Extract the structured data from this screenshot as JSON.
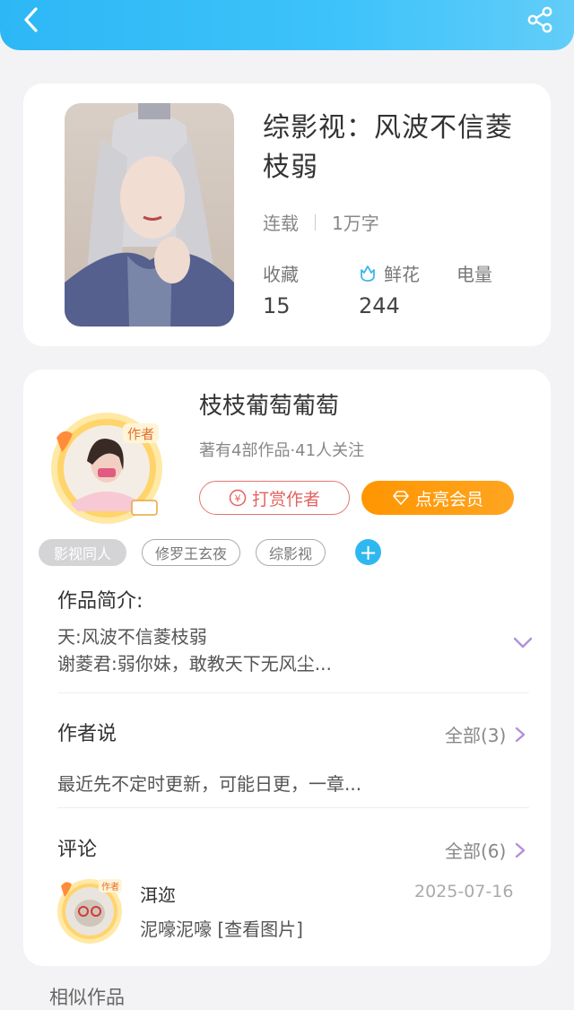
{
  "header": {
    "back_icon": "chevron-left-icon",
    "share_icon": "share-icon"
  },
  "book": {
    "title": "综影视：风波不信菱枝弱",
    "status": "连载",
    "word_count": "1万字",
    "stats": {
      "favorites_label": "收藏",
      "favorites_value": "15",
      "flowers_label": "鲜花",
      "flowers_value": "244",
      "power_label": "电量"
    }
  },
  "author": {
    "name": "枝枝葡萄葡萄",
    "info": "著有4部作品·41人关注",
    "badge": "作者",
    "reward_button": "打赏作者",
    "vip_button": "点亮会员",
    "tags": [
      "影视同人",
      "修罗王玄夜",
      "综影视"
    ],
    "add_tag": "+"
  },
  "intro": {
    "title": "作品简介:",
    "line1": "天:风波不信菱枝弱",
    "line2": "谢菱君:弱你妹，敢教天下无风尘..."
  },
  "author_say": {
    "title": "作者说",
    "more": "全部(3)",
    "text": "最近先不定时更新，可能日更，一章..."
  },
  "comments": {
    "title": "评论",
    "more": "全部(6)",
    "items": [
      {
        "user": "洱迩",
        "date": "2025-07-16",
        "text": "泥嚎泥嚎 [查看图片]",
        "badge": "作者"
      }
    ]
  },
  "similar": {
    "title": "相似作品"
  },
  "colors": {
    "accent": "#2db7f5",
    "vip": "#ff9500",
    "reward": "#e5625f",
    "purple": "#b48fd8"
  }
}
